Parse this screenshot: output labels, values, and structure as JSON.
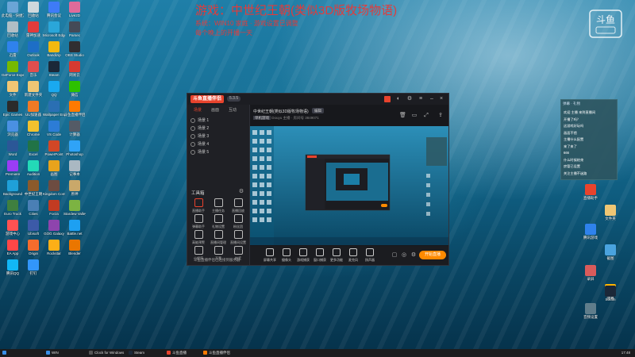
{
  "overlay": {
    "title": "游戏：中世纪王朝(类似3D版牧场物语)",
    "line1": "系统：WIN10 家庭 · 游戏设置已调整",
    "line2": "每个晚上的开播一天"
  },
  "desktop_icons": [
    {
      "label": "此电脑 - 快捷方式",
      "color": "#6aa5d6"
    },
    {
      "label": "回收站",
      "color": "#cfd8dc"
    },
    {
      "label": "腾讯会议",
      "color": "#3e7bf7"
    },
    {
      "label": "Live2D",
      "color": "#e06b9a"
    },
    {
      "label": "回收站",
      "color": "#b0bec5"
    },
    {
      "label": "雷神加速",
      "color": "#e23b3b"
    },
    {
      "label": "Microsoft Edge",
      "color": "#2aa6d9"
    },
    {
      "label": "Parsec",
      "color": "#444a57"
    },
    {
      "label": "迅雷",
      "color": "#2f82ec"
    },
    {
      "label": "Outlook",
      "color": "#1d6ec6"
    },
    {
      "label": "Bandizip",
      "color": "#f2b90f"
    },
    {
      "label": "OBS Studio",
      "color": "#302e31"
    },
    {
      "label": "GeForce Experience",
      "color": "#76b900"
    },
    {
      "label": "音乐",
      "color": "#e04e4e"
    },
    {
      "label": "Steam",
      "color": "#1b2838"
    },
    {
      "label": "网易云",
      "color": "#d73a31"
    },
    {
      "label": "文件",
      "color": "#f0c674"
    },
    {
      "label": "新建文件夹",
      "color": "#f0c674"
    },
    {
      "label": "QQ",
      "color": "#19a9f0"
    },
    {
      "label": "微信",
      "color": "#2dc100"
    },
    {
      "label": "Epic Games",
      "color": "#2b2b2b"
    },
    {
      "label": "UU加速器",
      "color": "#f07a25"
    },
    {
      "label": "Wallpaper Engine",
      "color": "#2a6fb3"
    },
    {
      "label": "斗鱼直播伴侣",
      "color": "#ff7a00"
    },
    {
      "label": "浏览器",
      "color": "#4a90e2"
    },
    {
      "label": "Chrome",
      "color": "#f2c12e"
    },
    {
      "label": "VS Code",
      "color": "#2c7cd6"
    },
    {
      "label": "计算器",
      "color": "#545b66"
    },
    {
      "label": "Word",
      "color": "#2b5797"
    },
    {
      "label": "Excel",
      "color": "#217346"
    },
    {
      "label": "PowerPoint",
      "color": "#d24726"
    },
    {
      "label": "Photoshop",
      "color": "#2fa3f7"
    },
    {
      "label": "Premiere",
      "color": "#9a3df5"
    },
    {
      "label": "Audition",
      "color": "#23d9b7"
    },
    {
      "label": "画图",
      "color": "#e8a31c"
    },
    {
      "label": "记事本",
      "color": "#aab8c2"
    },
    {
      "label": "Background",
      "color": "#1fa0d8"
    },
    {
      "label": "中世纪王朝",
      "color": "#8b5a2b"
    },
    {
      "label": "Kingdom Come",
      "color": "#6d4c41"
    },
    {
      "label": "原神",
      "color": "#c9a86a"
    },
    {
      "label": "Euro Truck",
      "color": "#3f7f3f"
    },
    {
      "label": "Cities",
      "color": "#4a7fb5"
    },
    {
      "label": "Forza",
      "color": "#c23b22"
    },
    {
      "label": "Stardew Valley",
      "color": "#7cb342"
    },
    {
      "label": "游戏中心",
      "color": "#ff5252"
    },
    {
      "label": "Ubisoft",
      "color": "#3c5aa8"
    },
    {
      "label": "GOG Galaxy",
      "color": "#8e44ad"
    },
    {
      "label": "Battle.net",
      "color": "#1da0f2"
    },
    {
      "label": "EA App",
      "color": "#ff4747"
    },
    {
      "label": "Origin",
      "color": "#f56c2d"
    },
    {
      "label": "Rockstar",
      "color": "#fcaf17"
    },
    {
      "label": "Blender",
      "color": "#ea7600"
    },
    {
      "label": "腾讯QQ",
      "color": "#12b7f5"
    },
    {
      "label": "钉钉",
      "color": "#3296fa"
    }
  ],
  "right_icons": [
    {
      "label": "直播助手",
      "color": "#e8432d"
    },
    {
      "label": "文件夹",
      "color": "#f0c674"
    },
    {
      "label": "腾讯游戏",
      "color": "#2f82ec"
    },
    {
      "label": "截图",
      "color": "#4aa3df"
    },
    {
      "label": "录屏",
      "color": "#d95b5b"
    },
    {
      "label": "弹幕",
      "color": "#ffb300"
    },
    {
      "label": "音频设置",
      "color": "#607d8b"
    },
    {
      "label": "Steam",
      "color": "#1b2838"
    }
  ],
  "app": {
    "brand": "斗鱼直播伴侣",
    "version": "5.3.5",
    "tabs": [
      "场景",
      "画面",
      "互动"
    ],
    "scenes": [
      "场景 1",
      "场景 2",
      "场景 3",
      "场景 4",
      "场景 5"
    ],
    "tools_title": "工具箱",
    "tools": [
      "直播助手",
      "主播任务",
      "直播回放",
      "弹幕助手",
      "礼物设置",
      "粉丝团",
      "高能预警",
      "直播间管理",
      "直播间设置",
      "小程序",
      "开黑",
      "抽奖"
    ],
    "bottom_note": "斗鱼直播伴侣已连接到服务器",
    "stream_title": "中世纪王朝(类似3D版牧场物语)",
    "edit_label": "编辑",
    "category_pill": "单机游戏",
    "meta_text": "Douyu 主播 · 房间号 3849071",
    "controls": [
      "屏幕共享",
      "摄像头",
      "游戏捕获",
      "窗口捕获",
      "更多功能",
      "麦克风",
      "扬声器"
    ],
    "live_button": "开始直播"
  },
  "chat": {
    "header": "弹幕 · 礼物",
    "lines": [
      "欢迎 主播 来到直播间",
      "开播了吗？",
      "这游戏好玩吗",
      "画面不错",
      "主播什么配置",
      "来了来了",
      "666",
      "什么时候结束",
      "房管已设置",
      "关注主播不迷路"
    ]
  },
  "taskbar": {
    "items": [
      {
        "label": "WIN",
        "color": "#3a8ee6"
      },
      {
        "label": "Clock for Windows",
        "color": "#555"
      },
      {
        "label": "Steam",
        "color": "#1b2838"
      },
      {
        "label": "斗鱼直播",
        "color": "#e8432d"
      },
      {
        "label": "斗鱼直播伴侣",
        "color": "#ff7a00"
      }
    ],
    "clock": "17:48"
  },
  "logo_text": "斗鱼"
}
